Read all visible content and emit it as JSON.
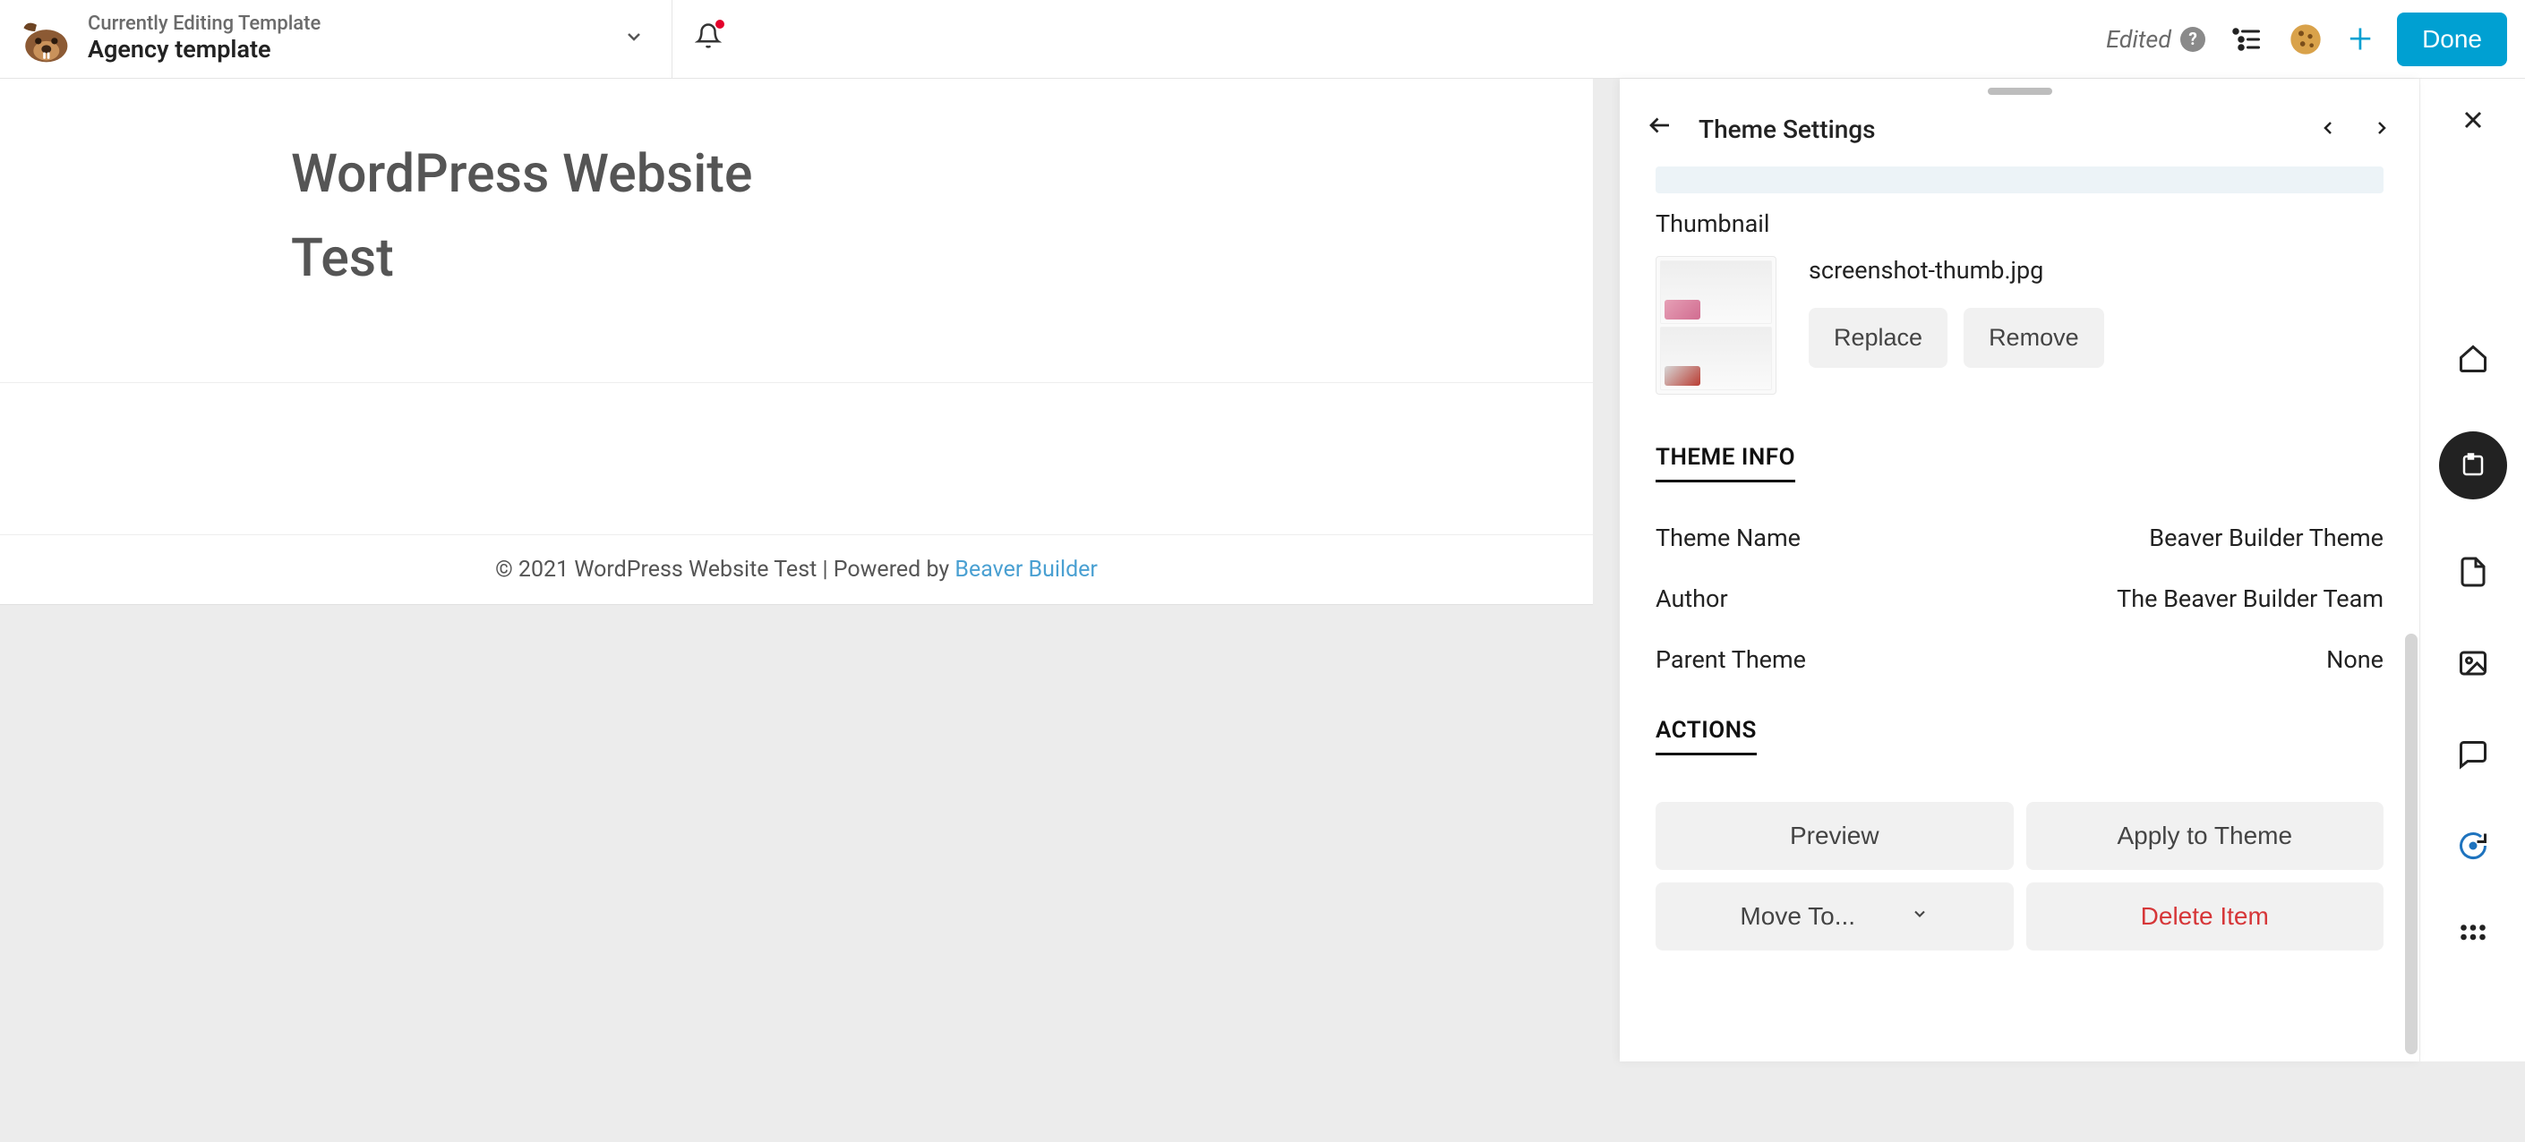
{
  "topbar": {
    "subtitle": "Currently Editing Template",
    "title": "Agency template",
    "edited_label": "Edited",
    "done_label": "Done"
  },
  "canvas": {
    "site_heading_line1": "WordPress Website",
    "site_heading_line2": "Test",
    "footer_text": "© 2021 WordPress Website Test | Powered by ",
    "footer_link": "Beaver Builder"
  },
  "panel": {
    "title": "Theme Settings",
    "thumbnail_label": "Thumbnail",
    "thumbnail_filename": "screenshot-thumb.jpg",
    "replace_label": "Replace",
    "remove_label": "Remove",
    "theme_info_heading": "THEME INFO",
    "info": [
      {
        "label": "Theme Name",
        "value": "Beaver Builder Theme"
      },
      {
        "label": "Author",
        "value": "The Beaver Builder Team"
      },
      {
        "label": "Parent Theme",
        "value": "None"
      }
    ],
    "actions_heading": "ACTIONS",
    "actions": {
      "preview": "Preview",
      "apply": "Apply to Theme",
      "move_to": "Move To...",
      "delete": "Delete Item"
    }
  }
}
